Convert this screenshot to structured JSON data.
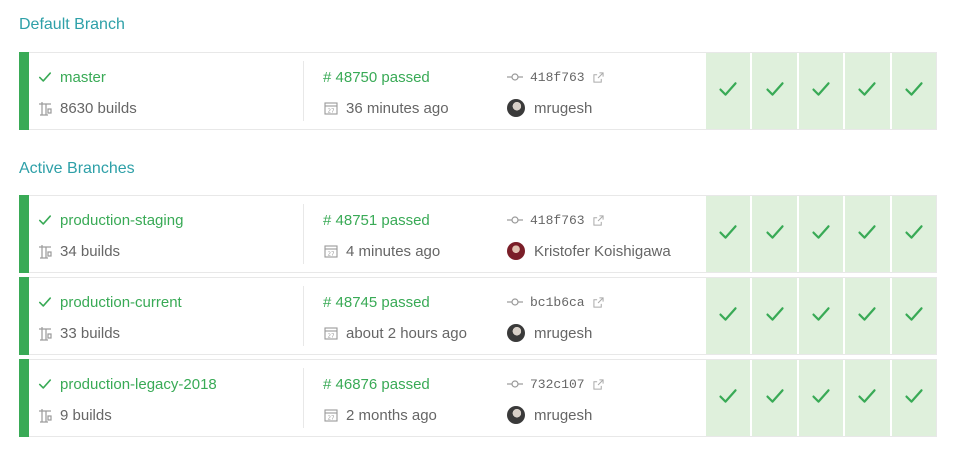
{
  "sections": {
    "default_title": "Default Branch",
    "active_title": "Active Branches"
  },
  "colors": {
    "passed": "#39aa56",
    "history_bg": "#dff0dc",
    "accent": "#2ea0a8"
  },
  "branches": [
    {
      "name": "master",
      "builds": "8630 builds",
      "build_number": "# 48750 passed",
      "time": "36 minutes ago",
      "commit": "418f763",
      "author": "mrugesh",
      "avatar": "dark",
      "history": [
        "passed",
        "passed",
        "passed",
        "passed",
        "passed"
      ]
    },
    {
      "name": "production-staging",
      "builds": "34 builds",
      "build_number": "# 48751 passed",
      "time": "4 minutes ago",
      "commit": "418f763",
      "author": "Kristofer Koishigawa",
      "avatar": "red",
      "history": [
        "passed",
        "passed",
        "passed",
        "passed",
        "passed"
      ]
    },
    {
      "name": "production-current",
      "builds": "33 builds",
      "build_number": "# 48745 passed",
      "time": "about 2 hours ago",
      "commit": "bc1b6ca",
      "author": "mrugesh",
      "avatar": "dark",
      "history": [
        "passed",
        "passed",
        "passed",
        "passed",
        "passed"
      ]
    },
    {
      "name": "production-legacy-2018",
      "builds": "9 builds",
      "build_number": "# 46876 passed",
      "time": "2 months ago",
      "commit": "732c107",
      "author": "mrugesh",
      "avatar": "dark",
      "history": [
        "passed",
        "passed",
        "passed",
        "passed",
        "passed"
      ]
    }
  ]
}
